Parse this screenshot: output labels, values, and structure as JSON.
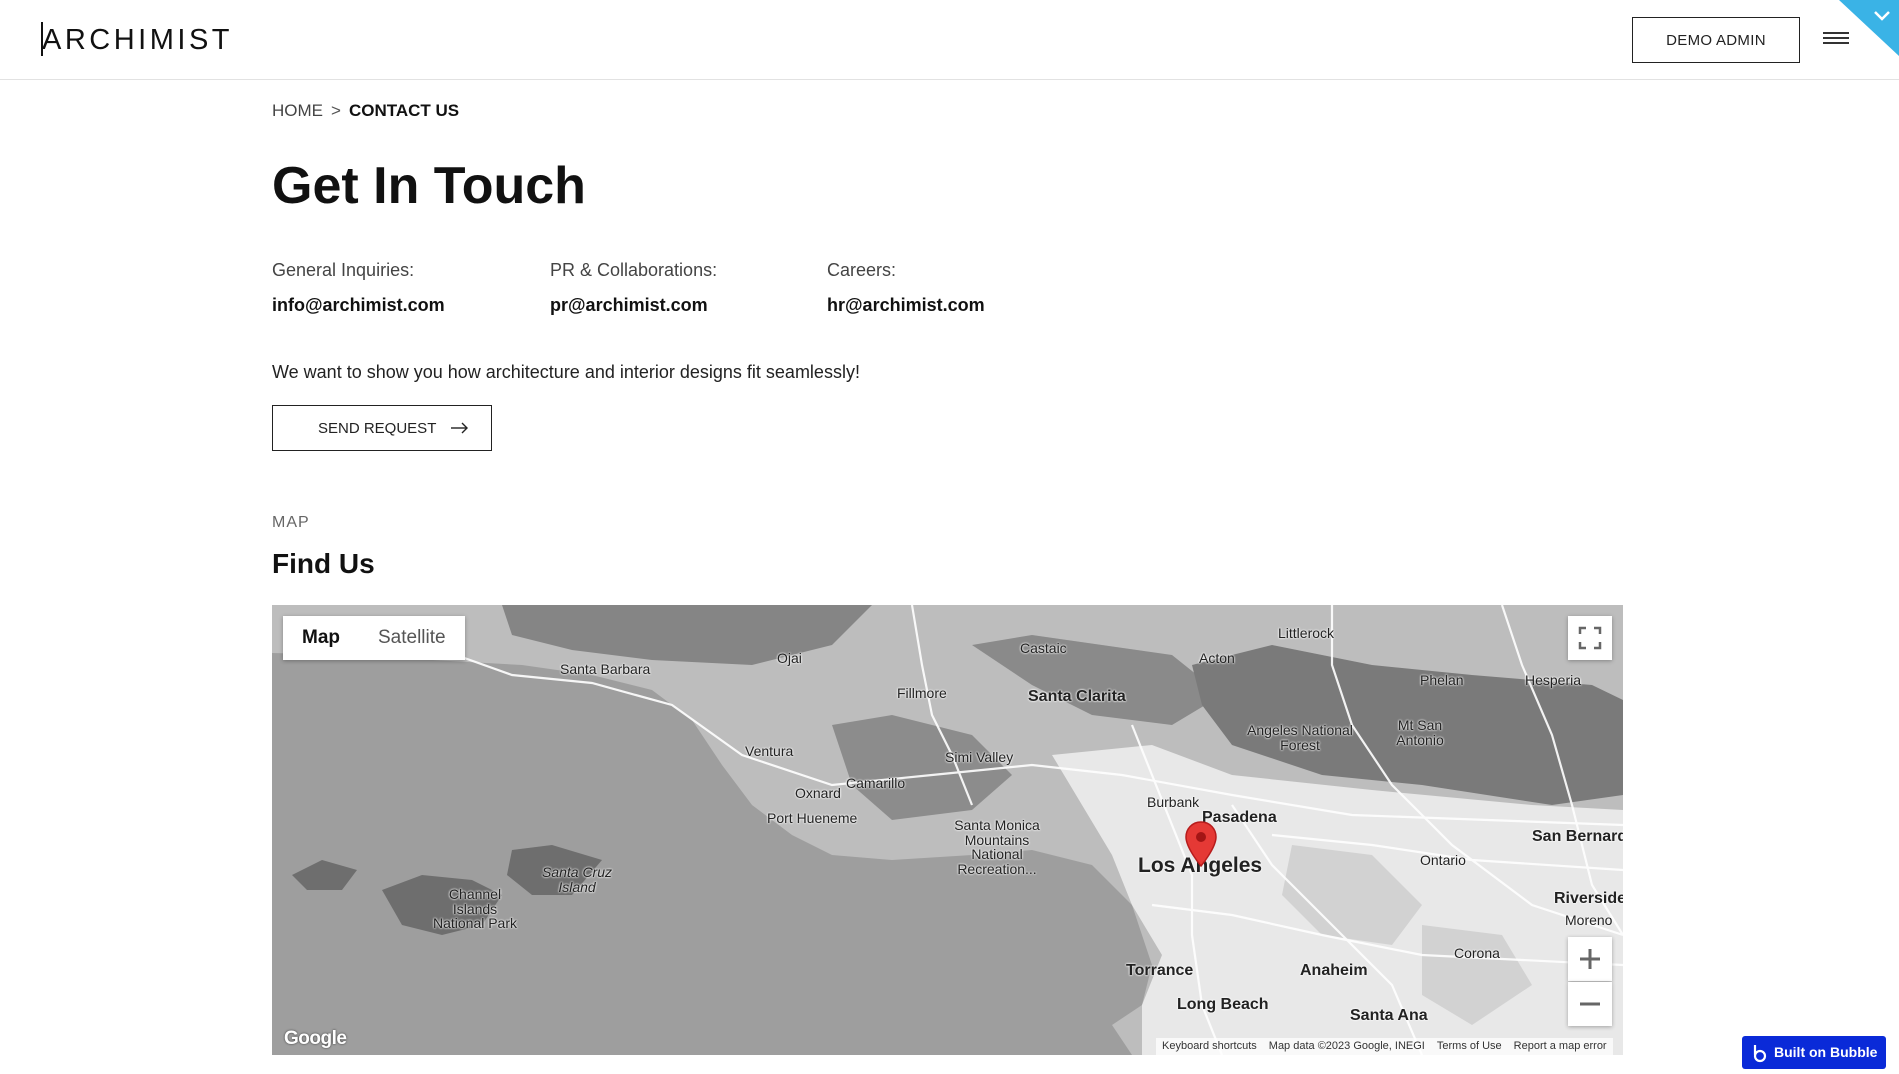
{
  "header": {
    "logo": "ARCHIMIST",
    "admin_button": "DEMO ADMIN",
    "colors": {
      "border": "#e2e2e2",
      "corner_tab": "#3ab3e6"
    }
  },
  "breadcrumb": {
    "home": "HOME",
    "separator": ">",
    "current": "CONTACT US"
  },
  "page_title": "Get In Touch",
  "contacts": [
    {
      "label": "General Inquiries:",
      "email": "info@archimist.com"
    },
    {
      "label": "PR & Collaborations:",
      "email": "pr@archimist.com"
    },
    {
      "label": "Careers:",
      "email": "hr@archimist.com"
    }
  ],
  "tagline": "We want to show you how architecture and interior designs fit seamlessly!",
  "send_button": {
    "label": "SEND REQUEST",
    "icon": "arrow-right-icon"
  },
  "map_section": {
    "eyebrow": "MAP",
    "title": "Find Us"
  },
  "map": {
    "type_options": [
      "Map",
      "Satellite"
    ],
    "selected_type": "Map",
    "provider_logo": "Google",
    "attribution": [
      "Keyboard shortcuts",
      "Map data ©2023 Google, INEGI",
      "Terms of Use",
      "Report a map error"
    ],
    "places": [
      "Santa Barbara",
      "Ojai",
      "Castaic",
      "Littlerock",
      "Acton",
      "Phelan",
      "Hesperia",
      "Fillmore",
      "Santa Clarita",
      "Angeles National Forest",
      "Mt San Antonio",
      "Ventura",
      "Simi Valley",
      "Camarillo",
      "Oxnard",
      "Port Hueneme",
      "Burbank",
      "Pasadena",
      "Los Angeles",
      "Santa Monica Mountains National Recreation...",
      "Santa Cruz Island",
      "Channel Islands National Park",
      "Ontario",
      "Riverside",
      "San Bernard",
      "Moreno",
      "Corona",
      "Torrance",
      "Anaheim",
      "Long Beach",
      "Santa Ana"
    ],
    "colors": {
      "ocean": "#9e9e9e",
      "land": "#bdbdbd",
      "urban": "#e8e8e8",
      "pin": "#e53935"
    }
  },
  "built_on_bubble": {
    "label": "Built on Bubble",
    "color": "#0a2ad8"
  }
}
